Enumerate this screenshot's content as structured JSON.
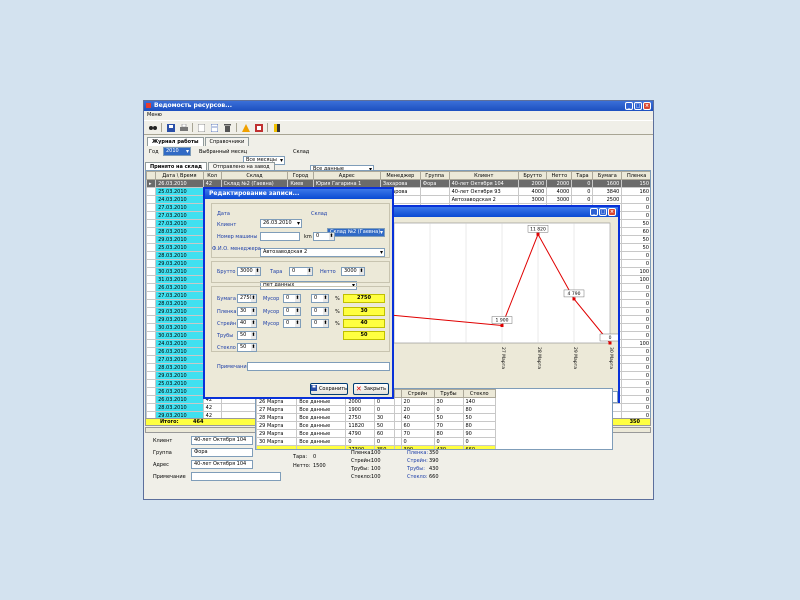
{
  "window": {
    "title": "Ведомость ресурсов..."
  },
  "menu": {
    "item": "Меню"
  },
  "tabs": [
    "Журнал работы",
    "Справочники"
  ],
  "filters": {
    "year_label": "Год",
    "year": "2010",
    "month_label": "Выбранный месяц",
    "month": "Все месяцы",
    "warehouse_label": "Склад",
    "warehouse": "Все данные"
  },
  "subtabs": [
    "Принято на склад",
    "Отправлено на завод"
  ],
  "grid": {
    "headers": [
      "Дата \\ Время",
      "Кол",
      "Склад",
      "Город",
      "Адрес",
      "Менеджер",
      "Группа",
      "Клиент",
      "Брутто",
      "Нетто",
      "Тара",
      "Бумага",
      "Пленка"
    ],
    "rows": [
      [
        "26.03.2010",
        "42",
        "Склад №2 (Гаевна)",
        "Киев",
        "Юрия Гагарина 1",
        "Захарова",
        "Фора",
        "40-лет Октября 104",
        "2000",
        "2000",
        "0",
        "1600",
        "150"
      ],
      [
        "25.03.2010",
        "42",
        "Склад №2 (Гаевна)",
        "Киев",
        "Юрия Гагарина 1/2",
        "Захарова",
        "",
        "40-лет Октября 93",
        "4000",
        "4000",
        "0",
        "3840",
        "160"
      ],
      [
        "24.03.2010",
        "",
        "",
        "",
        "",
        "",
        "",
        "Автозаводская 2",
        "3000",
        "3000",
        "0",
        "2500",
        "0"
      ],
      [
        "27.03.2010",
        "64",
        "",
        "",
        "",
        "",
        "",
        "",
        "",
        "",
        "",
        "",
        "0"
      ],
      [
        "27.03.2010",
        "64",
        "",
        "",
        "",
        "",
        "",
        "",
        "",
        "",
        "",
        "",
        "0"
      ],
      [
        "27.03.2010",
        "42",
        "",
        "",
        "",
        "",
        "",
        "",
        "",
        "",
        "",
        "",
        "50"
      ],
      [
        "28.03.2010",
        "42",
        "",
        "",
        "",
        "",
        "",
        "",
        "",
        "",
        "",
        "",
        "60"
      ],
      [
        "29.03.2010",
        "0",
        "",
        "",
        "",
        "",
        "",
        "",
        "",
        "",
        "",
        "",
        "50"
      ],
      [
        "25.03.2010",
        "0",
        "",
        "",
        "",
        "",
        "",
        "",
        "",
        "",
        "",
        "",
        "50"
      ],
      [
        "28.03.2010",
        "0",
        "",
        "",
        "",
        "",
        "",
        "",
        "",
        "",
        "",
        "",
        "0"
      ],
      [
        "29.03.2010",
        "42",
        "",
        "",
        "",
        "",
        "",
        "",
        "",
        "",
        "",
        "",
        "0"
      ],
      [
        "30.03.2010",
        "42",
        "",
        "",
        "",
        "",
        "",
        "",
        "",
        "",
        "",
        "",
        "100"
      ],
      [
        "31.03.2010",
        "42",
        "",
        "",
        "",
        "",
        "",
        "",
        "",
        "",
        "",
        "",
        "100"
      ],
      [
        "26.03.2010",
        "42",
        "",
        "",
        "",
        "",
        "",
        "",
        "",
        "",
        "",
        "",
        "0"
      ],
      [
        "27.03.2010",
        "64",
        "",
        "",
        "",
        "",
        "",
        "",
        "",
        "",
        "",
        "",
        "0"
      ],
      [
        "28.03.2010",
        "64",
        "",
        "",
        "",
        "",
        "",
        "",
        "",
        "",
        "",
        "",
        "0"
      ],
      [
        "29.03.2010",
        "42",
        "",
        "",
        "",
        "",
        "",
        "",
        "",
        "",
        "",
        "",
        "0"
      ],
      [
        "29.03.2010",
        "42",
        "",
        "",
        "",
        "",
        "",
        "",
        "",
        "",
        "",
        "",
        "0"
      ],
      [
        "30.03.2010",
        "42",
        "",
        "",
        "",
        "",
        "",
        "",
        "",
        "",
        "",
        "",
        "0"
      ],
      [
        "30.03.2010",
        "0",
        "",
        "",
        "",
        "",
        "",
        "",
        "",
        "",
        "",
        "",
        "0"
      ],
      [
        "24.03.2010",
        "0",
        "",
        "",
        "",
        "",
        "",
        "",
        "",
        "",
        "",
        "",
        "100"
      ],
      [
        "26.03.2010",
        "42",
        "",
        "",
        "",
        "",
        "",
        "",
        "",
        "",
        "",
        "",
        "0"
      ],
      [
        "27.03.2010",
        "42",
        "",
        "",
        "",
        "",
        "",
        "",
        "",
        "",
        "",
        "",
        "0"
      ],
      [
        "28.03.2010",
        "42",
        "",
        "",
        "",
        "",
        "",
        "",
        "",
        "",
        "",
        "",
        "0"
      ],
      [
        "29.03.2010",
        "42",
        "",
        "",
        "",
        "",
        "",
        "",
        "",
        "",
        "",
        "",
        "0"
      ],
      [
        "25.03.2010",
        "64",
        "",
        "",
        "",
        "",
        "",
        "",
        "",
        "",
        "",
        "",
        "0"
      ],
      [
        "26.03.2010",
        "42",
        "",
        "",
        "",
        "",
        "",
        "",
        "",
        "",
        "",
        "",
        "0"
      ],
      [
        "26.03.2010",
        "42",
        "",
        "",
        "",
        "",
        "",
        "",
        "",
        "",
        "",
        "",
        "0"
      ],
      [
        "28.03.2010",
        "42",
        "",
        "",
        "",
        "",
        "",
        "",
        "",
        "",
        "",
        "",
        "0"
      ],
      [
        "29.03.2010",
        "42",
        "",
        "",
        "",
        "",
        "",
        "",
        "",
        "",
        "",
        "",
        "0"
      ],
      [
        "29.03.2010",
        "42",
        "Склад №2 (Гаевна)",
        "",
        "",
        "",
        "",
        "",
        "",
        "",
        "",
        "",
        "0"
      ],
      [
        "30.03.2010",
        "42",
        "Склад №2 (Гаевна)",
        "",
        "",
        "",
        "",
        "",
        "",
        "",
        "",
        "",
        "0"
      ]
    ],
    "totals": {
      "label": "Итого:",
      "qty": "464",
      "last": "350"
    }
  },
  "detail": {
    "client_label": "Клиент",
    "client": "40-лет Октября 104",
    "group_label": "Группа",
    "group": "Фора",
    "address_label": "Адрес",
    "address": "40-лет Октября 104",
    "note_label": "Примечание",
    "tare_label": "Тара:",
    "tare": "0",
    "net_label": "Нетто:",
    "net": "1500",
    "film_label": "Пленка:",
    "film": "100",
    "strein_label": "Стрейн:",
    "strein": "100",
    "pipes_label": "Трубы:",
    "pipes": "100",
    "glass_label": "Стекло:",
    "glass": "100",
    "r_film": "350",
    "r_strein": "390",
    "r_pipes": "430",
    "r_glass": "660"
  },
  "summary": {
    "rows": [
      [
        "26 Марта",
        "Все данные",
        "2000",
        "0",
        "",
        "20",
        "30",
        "140"
      ],
      [
        "27 Марта",
        "Все данные",
        "1900",
        "0",
        "",
        "20",
        "0",
        "80"
      ],
      [
        "28 Марта",
        "Все данные",
        "2750",
        "30",
        "",
        "40",
        "50",
        "50"
      ],
      [
        "29 Марта",
        "Все данные",
        "11820",
        "50",
        "",
        "60",
        "70",
        "80"
      ],
      [
        "29 Марта",
        "Все данные",
        "4790",
        "60",
        "",
        "70",
        "80",
        "90"
      ],
      [
        "30 Марта",
        "Все данные",
        "0",
        "0",
        "",
        "0",
        "0",
        "0"
      ]
    ],
    "headers": [
      "Стрейн",
      "Трубы",
      "Стекло"
    ],
    "totals": [
      "27300",
      "350",
      "390",
      "430",
      "660"
    ]
  },
  "chart_data": {
    "type": "line",
    "categories": [
      "",
      "",
      "",
      "27 Марта",
      "28 Марта",
      "29 Марта",
      "30 Марта"
    ],
    "series": [
      {
        "values": [
          null,
          null,
          null,
          1900,
          11820,
          4790,
          0
        ]
      }
    ],
    "labels": [
      "1 900",
      "11 820",
      "4 790",
      "0"
    ],
    "legend": [
      "Пленка",
      "Стрейн",
      "Трубы",
      "Стекло"
    ],
    "colors": {
      "line": "#e00000",
      "point": "#e00000"
    }
  },
  "dialog": {
    "title": "Редактирование записи...",
    "date_label": "Дата",
    "date": "26.03.2010",
    "warehouse_label": "Склад",
    "warehouse": "Склад №2 (Гаевна)",
    "client_label": "Клиент",
    "client": "Автозаводская 2",
    "car_label": "Номер машины",
    "km_label": "km",
    "km": "0",
    "manager_label": "Ф.И.О. менеджера",
    "manager": "Нет данных",
    "gross_label": "Брутто",
    "gross": "3000",
    "tare_label": "Тара",
    "tare": "0",
    "net_label": "Нетто",
    "net": "3000",
    "paper_label": "Бумага",
    "paper": "2750",
    "film_label": "Пленка",
    "film": "30",
    "strein_label": "Стрейн",
    "strein": "40",
    "pipes_label": "Трубы",
    "pipes": "50",
    "glass_label": "Стекло",
    "glass": "50",
    "trash_label": "Мусор",
    "zero": "0",
    "pct": "%",
    "y1": "2750",
    "y2": "30",
    "y3": "40",
    "y4": "50",
    "note_label": "Примечание",
    "save": "Сохранить",
    "close": "Закрыть"
  }
}
